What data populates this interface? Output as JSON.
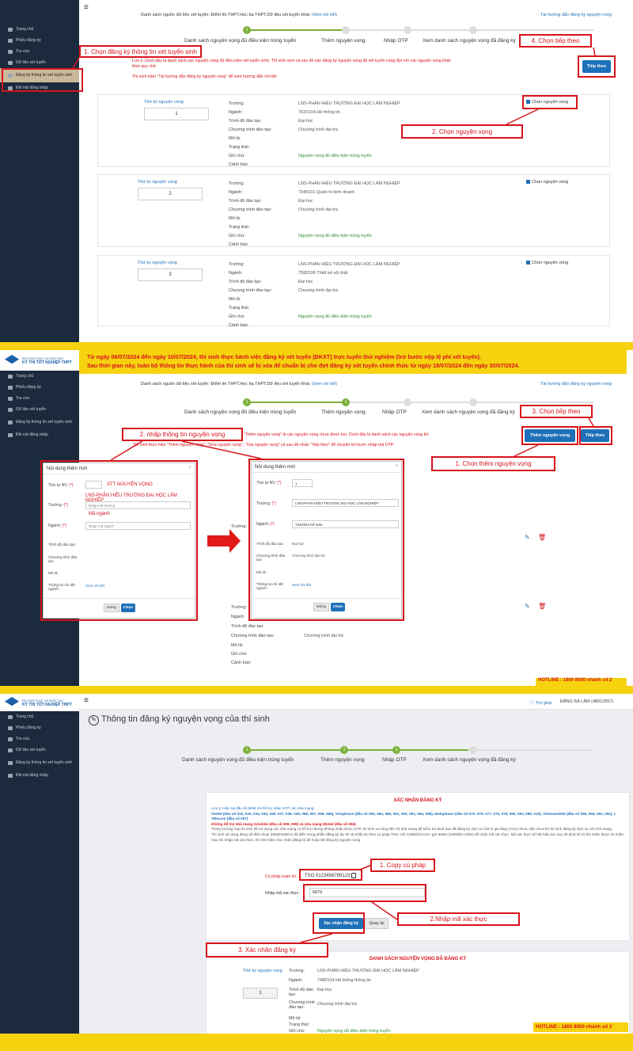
{
  "common": {
    "logo_line1": "BỘ GIÁO DỤC VÀ ĐÀO TẠO",
    "logo_line2": "KỲ THI TỐT NGHIỆP THPT",
    "menu": [
      "Trang chủ",
      "Phiếu đăng ký",
      "Tra cứu",
      "Dữ liệu xét tuyển",
      "Đăng ký thông tin xét tuyển sinh",
      "Đổi mã đăng nhập"
    ],
    "sources": "Danh sách nguồn dữ liệu xét tuyển: Điểm thi THPT,Học bạ THPT,Dữ liệu xét tuyển khác",
    "sources_link": "(Xem chi tiết)",
    "guide_link": "Tài hướng dẫn đăng ký nguyện vọng",
    "steps": [
      "Danh sách nguyện vọng đủ điều kiện trúng tuyển",
      "Thêm nguyện vọng",
      "Nhập OTP",
      "Xem danh sách nguyện vọng đã đăng ký"
    ],
    "next_btn": "Tiếp theo",
    "school": "LNS-PHÂN HIỆU TRƯỜNG ĐẠI HỌC LÂM NGHIỆP",
    "level": "Đại học",
    "program": "Chương trình đại trà",
    "eligible": "Nguyện vọng đủ điều kiện trúng tuyển",
    "choose_wish": "Chọn nguyện vọng",
    "labels": {
      "order": "Thứ tự nguyện vọng",
      "school": "Trường:",
      "major": "Ngành:",
      "level": "Trình độ đào tạo:",
      "program": "Chương trình đào tạo:",
      "desc": "Mô tả:",
      "status": "Trạng thái:",
      "note": "Ghi chú:",
      "warn": "Cảnh báo:"
    }
  },
  "panel1": {
    "note1": "Lưu ý: Dưới đây là danh sách các nguyện vọng đủ điều kiện xét tuyển sớm. Thí sinh xem và sau đó vào đăng ký nguyện vọng đã xét tuyển cùng đợt với các nguyện vọng khác theo quy chế.",
    "note2": "Thí sinh bấm \"Tài hướng dẫn đăng ký nguyện vọng\" để xem hướng dẫn chi tiết.",
    "cards": [
      {
        "num": "1",
        "major": "7620104-Hệ thống tin"
      },
      {
        "num": "2",
        "major": "7340101-Quản trị kinh doanh"
      },
      {
        "num": "3",
        "major": "7580108-Thiết kế nội thất"
      }
    ],
    "ann": [
      "1. Chọn đăng ký thông tin xét tuyển sinh",
      "2. Chọn nguyện vọng",
      "4. Chọn tiếp theo"
    ]
  },
  "panel2": {
    "banner1": "Từ ngày 06/07/2024 đến ngày 10/07/2024, thí sinh thực hành việc đăng ký xét tuyển (ĐKXT) trực tuyến thử nghiệm (trừ bước nộp lệ phí xét tuyển).",
    "banner2": "Sau thời gian này, toàn bộ thông tin thực hành của thí sinh sẽ bị xóa để chuẩn bị cho đợt đăng ký xét tuyển chính thức từ ngày 18/07/2024 đến ngày 30/07/2024.",
    "info1": "\"Thêm nguyện vọng\" là các nguyện vọng chưa được lưu. Dưới đây là danh sách các nguyện vọng thí",
    "info2": "Thí sinh thực hiện \"Thêm nguyện vọng\", \"Sửa nguyện vọng\", \"Xóa nguyện vọng\" và sau đó nhấn \"Tiếp theo\" để chuyển tới bước nhập mã OTP",
    "add_btn": "Thêm nguyện vọng",
    "modal_title": "Nội dung thêm mới",
    "m_order": "Thứ tự NV:",
    "m_school": "Trường:",
    "m_major": "Ngành:",
    "m_level": "Trình độ đào tạo:",
    "m_program": "Chương trình đào tạo:",
    "m_desc": "Mô tả:",
    "m_detail": "Thông tin chi tiết ngành:",
    "m_detail_link": "Xem chi tiết",
    "m_school_ph": "Nhập mã trường",
    "m_major_ph": "Nhập mã ngành",
    "hint_stt": "STT NGUYỆN VỌNG",
    "hint_school": "LNS-PHÂN HIỆU TRƯỜNG ĐẠI HỌC LÂM NGHIỆP",
    "hint_major": "Mã ngành",
    "close_btn": "Đóng",
    "choose_btn": "Chọn",
    "filled_order": "1",
    "filled_school": "LNS-PHÂN HIỆU TRƯỜNG ĐẠI HỌC LÂM NGHIỆP",
    "filled_major": "7340301-Kế toán",
    "hotline": "HOTLINE : 1800 8000 nhánh số 2",
    "ann": [
      "2. nhập thông tin nguyện vọng",
      "3. Chọn tiếp theo",
      "1. Chọn thêm nguyện vọng"
    ]
  },
  "panel3": {
    "help": "Trợ giúp",
    "user": "ĐẶNG BÁ LÂM (48012657)",
    "page_title": "Thông tin đăng ký nguyện vọng của thí sinh",
    "confirm_title": "XÁC NHẬN ĐĂNG KÝ",
    "otp_note": "Lưu ý: Hiện tại đầu số 6058 chỉ hỗ trợ nhận OTP các nhà mạng:",
    "carriers": "Viettel (đầu số 032, 033, 034, 035, 036, 037, 038, 039, 096, 097, 098, 086), Vinaphone (đầu số 083, 084, 085, 081, 082, 091, 094, 088), Mobiphone (đầu số 070, 079, 077, 076, 078, 090, 093, 089, 012), Vietnamobile (đầu số 056, 058, 092, 052), I-Telecom (đầu số 087)",
    "no_support": "Không hỗ trợ nhà mạng Gmobile (đầu số 059, 099) và nhà mạng Wintel (đầu số 055)",
    "otp_help": "Trong trường hợp thí sinh đã sử dụng các nhà mạng có hỗ trợ nhưng không nhận được OTP, thí sinh vui lòng liên hệ nhà mạng để kiểm tra thuê bao đã đăng ký dịch vụ Giá trị gia tăng (VAS) chưa, nếu chưa thì thí sinh đăng ký dịch vụ với nhà mạng.",
    "otp_send": "Thí sinh sử dụng đúng số điện thoại (0865015601) đã điền trong phiếu đăng ký dự thi và nhắn tin theo cú pháp TSO <số CMND/CCCD> gửi 6058 (1000đ/tin nhắn) để nhận mã xác thực. Mã xác thực sẽ hết hiệu lực sau 30 phút kể từ khi nhận được tin nhắn. Sau khi nhập mã xác thực, thí sinh bấm Xác nhận đăng ký để hoàn tất đăng ký nguyện vọng.",
    "syntax_label": "Cú pháp soạn tin:",
    "syntax": "TSO 0123456789123",
    "otp_label": "Nhập mã xác thực:",
    "otp_value": "6879",
    "confirm_btn": "Xác nhận đăng ký",
    "back_btn": "Quay lại",
    "list_title": "DANH SÁCH NGUYỆN VỌNG ĐÃ ĐĂNG KÝ",
    "list_major": "7480104-Hệ thống thông tin",
    "list_num": "1",
    "hotline": "HOTLINE : 1800 8000 nhánh số 2",
    "ann": [
      "1. Copy cú pháp",
      "2.Nhập mã xác thực",
      "3. Xác nhận đăng ký"
    ]
  }
}
